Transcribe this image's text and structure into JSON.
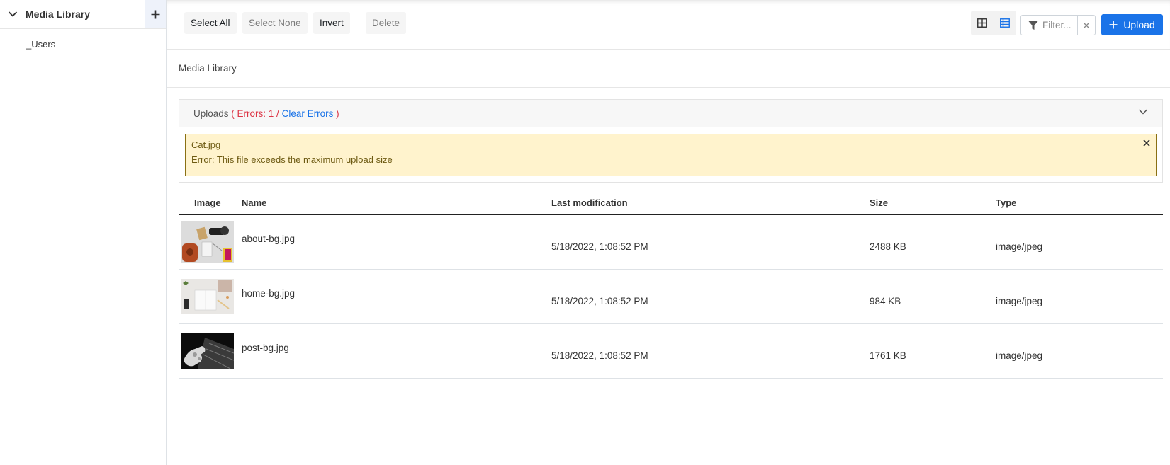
{
  "sidebar": {
    "title": "Media Library",
    "items": [
      {
        "label": "_Users"
      }
    ]
  },
  "toolbar": {
    "select_all": "Select All",
    "select_none": "Select None",
    "invert": "Invert",
    "delete": "Delete",
    "filter_placeholder": "Filter...",
    "upload": "Upload"
  },
  "breadcrumb": "Media Library",
  "uploads": {
    "label": "Uploads",
    "errors_text": "( Errors: 1 /",
    "clear_errors": "Clear Errors",
    "close_paren": ")",
    "error_file": "Cat.jpg",
    "error_message": "Error: This file exceeds the maximum upload size"
  },
  "table": {
    "columns": [
      "Image",
      "Name",
      "Last modification",
      "Size",
      "Type"
    ],
    "rows": [
      {
        "name": "about-bg.jpg",
        "modified": "5/18/2022, 1:08:52 PM",
        "size": "2488 KB",
        "type": "image/jpeg",
        "thumb": "desk-flatlay-icon"
      },
      {
        "name": "home-bg.jpg",
        "modified": "5/18/2022, 1:08:52 PM",
        "size": "984 KB",
        "type": "image/jpeg",
        "thumb": "notebook-icon"
      },
      {
        "name": "post-bg.jpg",
        "modified": "5/18/2022, 1:08:52 PM",
        "size": "1761 KB",
        "type": "image/jpeg",
        "thumb": "robot-hand-icon"
      }
    ]
  },
  "colors": {
    "accent": "#1a73e8",
    "error": "#dc3545",
    "warning_bg": "#fff3cd"
  }
}
